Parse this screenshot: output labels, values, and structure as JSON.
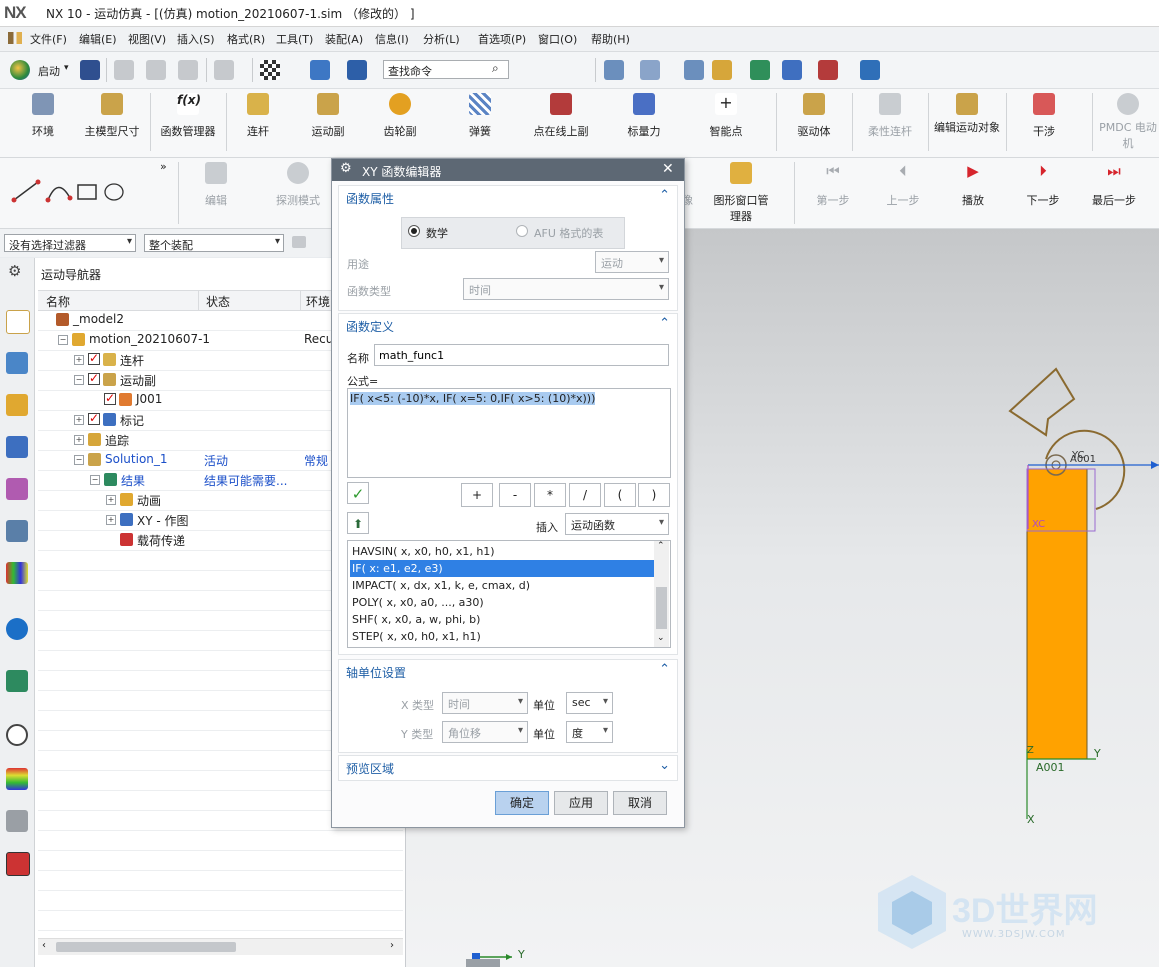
{
  "window": {
    "logo": "NX",
    "title": "NX 10 - 运动仿真 - [(仿真) motion_20210607-1.sim （修改的） ]"
  },
  "menu": [
    "文件(F)",
    "编辑(E)",
    "视图(V)",
    "插入(S)",
    "格式(R)",
    "工具(T)",
    "装配(A)",
    "信息(I)",
    "分析(L)",
    "首选项(P)",
    "窗口(O)",
    "帮助(H)"
  ],
  "toolbar": {
    "start_label": "启动",
    "search_placeholder": "查找命令"
  },
  "ribbon": [
    {
      "label": "环境",
      "enabled": true
    },
    {
      "label": "主模型尺寸",
      "enabled": true
    },
    {
      "label": "函数管理器",
      "enabled": true
    },
    {
      "label": "连杆",
      "enabled": true
    },
    {
      "label": "运动副",
      "enabled": true
    },
    {
      "label": "齿轮副",
      "enabled": true
    },
    {
      "label": "弹簧",
      "enabled": true
    },
    {
      "label": "点在线上副",
      "enabled": true
    },
    {
      "label": "标量力",
      "enabled": true
    },
    {
      "label": "智能点",
      "enabled": true
    },
    {
      "label": "驱动体",
      "enabled": true
    },
    {
      "label": "柔性连杆",
      "enabled": false
    },
    {
      "label": "编辑运动对象",
      "enabled": true
    },
    {
      "label": "干涉",
      "enabled": true
    },
    {
      "label": "PMDC 电动机",
      "enabled": false
    }
  ],
  "ribbon2": {
    "edit_label": "编辑",
    "probe_label": "探测模式",
    "image_label": "像",
    "graphics_mgr_label": "图形窗口管理器",
    "playback": [
      {
        "label": "第一步",
        "enabled": false
      },
      {
        "label": "上一步",
        "enabled": false
      },
      {
        "label": "播放",
        "enabled": true
      },
      {
        "label": "下一步",
        "enabled": true
      },
      {
        "label": "最后一步",
        "enabled": true
      }
    ]
  },
  "filters": {
    "selection_filter": "没有选择过滤器",
    "assembly_scope": "整个装配"
  },
  "navigator": {
    "title": "运动导航器",
    "columns": [
      "名称",
      "状态",
      "环境"
    ],
    "rows": [
      {
        "label": "_model2",
        "status": "",
        "env": "",
        "indent": 0,
        "exp": "",
        "chk": false
      },
      {
        "label": "motion_20210607-1",
        "status": "",
        "env": "Recu",
        "indent": 1,
        "exp": "−",
        "chk": false
      },
      {
        "label": "连杆",
        "status": "",
        "env": "",
        "indent": 2,
        "exp": "+",
        "chk": true
      },
      {
        "label": "运动副",
        "status": "",
        "env": "",
        "indent": 2,
        "exp": "−",
        "chk": true
      },
      {
        "label": "J001",
        "status": "",
        "env": "",
        "indent": 3,
        "exp": "",
        "chk": true
      },
      {
        "label": "标记",
        "status": "",
        "env": "",
        "indent": 2,
        "exp": "+",
        "chk": true
      },
      {
        "label": "追踪",
        "status": "",
        "env": "",
        "indent": 2,
        "exp": "+",
        "chk": false
      },
      {
        "label": "Solution_1",
        "status": "活动",
        "env": "常规",
        "indent": 2,
        "exp": "−",
        "chk": false,
        "blue": true
      },
      {
        "label": "结果",
        "status": "结果可能需要...",
        "env": "",
        "indent": 3,
        "exp": "−",
        "chk": false,
        "blue": true
      },
      {
        "label": "动画",
        "status": "",
        "env": "",
        "indent": 4,
        "exp": "+",
        "chk": false
      },
      {
        "label": "XY - 作图",
        "status": "",
        "env": "",
        "indent": 4,
        "exp": "+",
        "chk": false
      },
      {
        "label": "载荷传递",
        "status": "",
        "env": "",
        "indent": 4,
        "exp": "",
        "chk": false
      }
    ]
  },
  "dialog": {
    "title": "XY 函数编辑器",
    "section_properties": "函数属性",
    "radio_math": "数学",
    "radio_afu": "AFU 格式的表",
    "purpose_label": "用途",
    "purpose_value": "运动",
    "func_type_label": "函数类型",
    "func_type_value": "时间",
    "section_definition": "函数定义",
    "name_label": "名称",
    "name_value": "math_func1",
    "formula_label": "公式=",
    "formula_value": "IF( x<5: (-10)*x, IF( x=5: 0,IF( x>5: (10)*x)))",
    "operators": [
      "+",
      "-",
      "*",
      "/",
      "(",
      ")"
    ],
    "insert_label": "插入",
    "insert_value": "运动函数",
    "functions": [
      "HAVSIN( x, x0, h0, x1, h1)",
      "IF( x: e1, e2, e3)",
      "IMPACT( x, dx, x1, k, e, cmax, d)",
      "POLY( x, x0, a0, ..., a30)",
      "SHF( x, x0, a, w, phi, b)",
      "STEP( x, x0, h0, x1, h1)"
    ],
    "selected_function_index": 1,
    "section_axis": "轴单位设置",
    "x_type_label": "X 类型",
    "x_type_value": "时间",
    "x_unit_label": "单位",
    "x_unit_value": "sec",
    "y_type_label": "Y 类型",
    "y_type_value": "角位移",
    "y_unit_label": "单位",
    "y_unit_value": "度",
    "section_preview": "预览区域",
    "ok": "确定",
    "apply": "应用",
    "cancel": "取消"
  },
  "viewport": {
    "labels": {
      "yc": "YC",
      "a001_top": "A001",
      "xc": "XC",
      "a001_bottom": "A001",
      "y_axis": "Y",
      "x_axis": "X",
      "z_axis": "Z",
      "triad_y": "Y"
    },
    "part_color": "#ffa200"
  },
  "watermark": {
    "title": "3D世界网",
    "url": "WWW.3DSJW.COM"
  }
}
